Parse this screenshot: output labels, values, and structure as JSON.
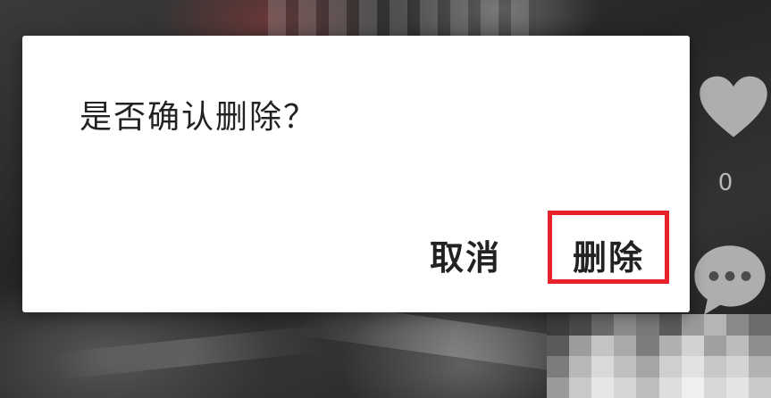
{
  "dialog": {
    "message": "是否确认删除？",
    "cancel_label": "取消",
    "delete_label": "删除"
  },
  "side_actions": {
    "like_count": "0",
    "like_icon": "heart-icon",
    "comment_icon": "comment-icon"
  },
  "colors": {
    "dialog_background": "#ffffff",
    "text": "#222222",
    "highlight": "#e8222b"
  }
}
